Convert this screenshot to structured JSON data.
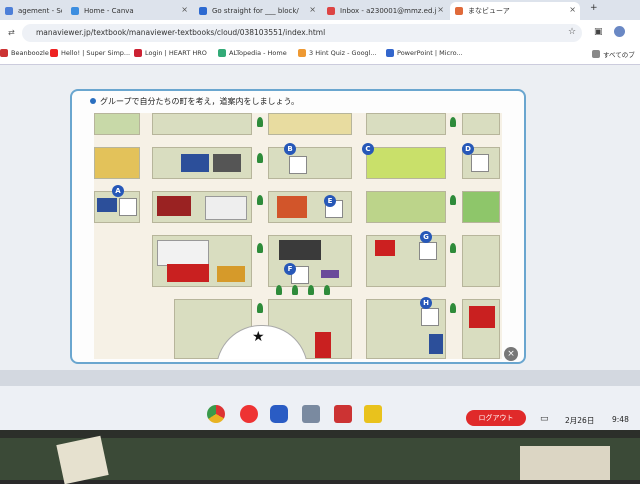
{
  "browser": {
    "tabs": [
      {
        "title": "agement - Sc",
        "color": "#4d7fd8"
      },
      {
        "title": "Home - Canva",
        "color": "#3c8ee0"
      },
      {
        "title": "Go straight for ___ block/",
        "color": "#2d6ad1"
      },
      {
        "title": "Inbox - a230001@mmz.ed.j",
        "color": "#d44"
      },
      {
        "title": "まなビューア",
        "color": "#e06a3a"
      }
    ],
    "new_tab": "+",
    "url": "manaviewer.jp/textbook/manaviewer-textbooks/cloud/038103551/index.html",
    "bookmarks": [
      {
        "label": "Beanboozle",
        "color": "#c33"
      },
      {
        "label": "Hello! | Super Simp...",
        "color": "#e22"
      },
      {
        "label": "Login | HEART HRO",
        "color": "#c23"
      },
      {
        "label": "ALTopedia - Home",
        "color": "#3a7"
      },
      {
        "label": "3 Hint Quiz - Googl...",
        "color": "#e93"
      },
      {
        "label": "PowerPoint | Micro...",
        "color": "#36c"
      }
    ],
    "all_bookmarks": "すべてのブ"
  },
  "lesson": {
    "instruction": "グループで自分たちの町を考え，道案内をしましょう。",
    "markers": [
      "A",
      "B",
      "C",
      "D",
      "E",
      "F",
      "G",
      "H"
    ],
    "start_symbol": "★",
    "close_symbol": "×"
  },
  "taskbar": {
    "logout_label": "ログアウト",
    "date": "2月26日",
    "time": "9:48",
    "apps": [
      {
        "name": "chrome",
        "color": "#e8b322"
      },
      {
        "name": "app-red",
        "color": "#e33"
      },
      {
        "name": "app-blue",
        "color": "#2a5cc4"
      },
      {
        "name": "app-gray",
        "color": "#7a8aa0"
      },
      {
        "name": "app-n",
        "color": "#c33"
      },
      {
        "name": "app-yellow",
        "color": "#e9c21c"
      }
    ]
  }
}
